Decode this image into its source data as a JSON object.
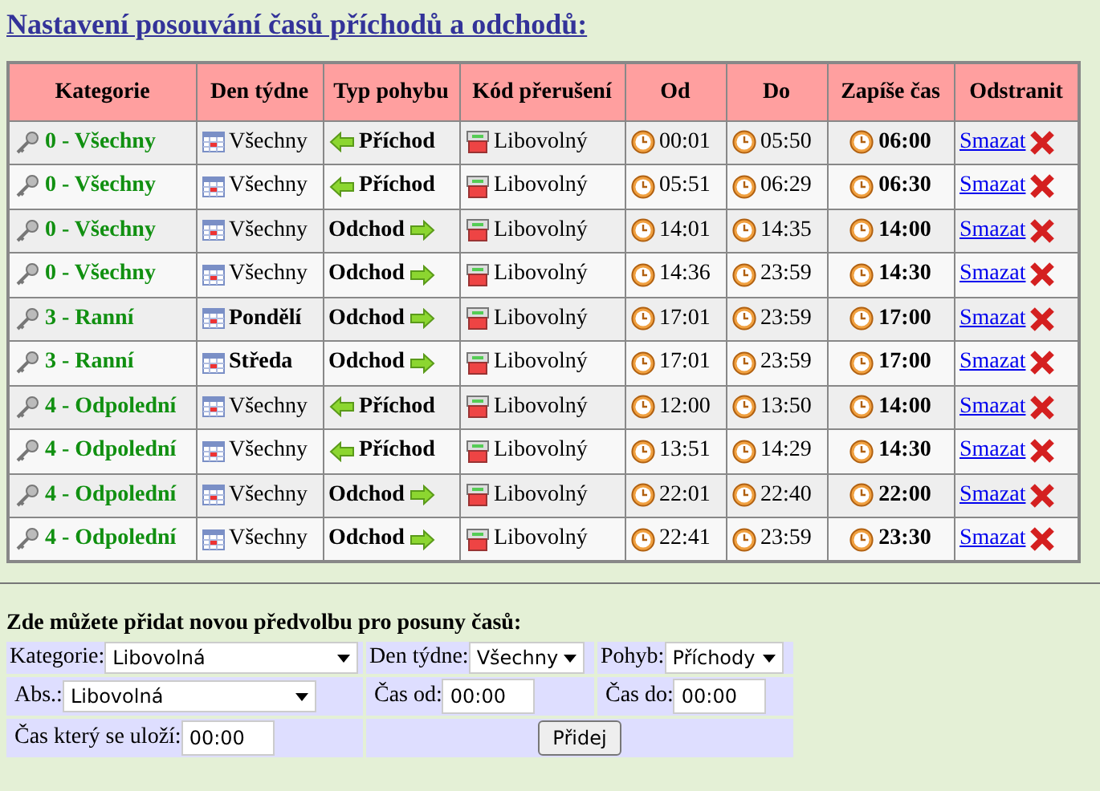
{
  "title": "Nastavení posouvání časů příchodů a odchodů:",
  "table": {
    "columns": [
      "Kategorie",
      "Den týdne",
      "Typ pohybu",
      "Kód přerušení",
      "Od",
      "Do",
      "Zapíše čas",
      "Odstranit"
    ],
    "rows": [
      {
        "category": "0 - Všechny",
        "day": "Všechny",
        "day_bold": false,
        "movement": "Příchod",
        "kind": "in",
        "code": "Libovolný",
        "from": "00:01",
        "to": "05:50",
        "save": "06:00",
        "delete": "Smazat"
      },
      {
        "category": "0 - Všechny",
        "day": "Všechny",
        "day_bold": false,
        "movement": "Příchod",
        "kind": "in",
        "code": "Libovolný",
        "from": "05:51",
        "to": "06:29",
        "save": "06:30",
        "delete": "Smazat"
      },
      {
        "category": "0 - Všechny",
        "day": "Všechny",
        "day_bold": false,
        "movement": "Odchod",
        "kind": "out",
        "code": "Libovolný",
        "from": "14:01",
        "to": "14:35",
        "save": "14:00",
        "delete": "Smazat"
      },
      {
        "category": "0 - Všechny",
        "day": "Všechny",
        "day_bold": false,
        "movement": "Odchod",
        "kind": "out",
        "code": "Libovolný",
        "from": "14:36",
        "to": "23:59",
        "save": "14:30",
        "delete": "Smazat"
      },
      {
        "category": "3 - Ranní",
        "day": "Pondělí",
        "day_bold": true,
        "movement": "Odchod",
        "kind": "out",
        "code": "Libovolný",
        "from": "17:01",
        "to": "23:59",
        "save": "17:00",
        "delete": "Smazat"
      },
      {
        "category": "3 - Ranní",
        "day": "Středa",
        "day_bold": true,
        "movement": "Odchod",
        "kind": "out",
        "code": "Libovolný",
        "from": "17:01",
        "to": "23:59",
        "save": "17:00",
        "delete": "Smazat"
      },
      {
        "category": "4 - Odpolední",
        "day": "Všechny",
        "day_bold": false,
        "movement": "Příchod",
        "kind": "in",
        "code": "Libovolný",
        "from": "12:00",
        "to": "13:50",
        "save": "14:00",
        "delete": "Smazat"
      },
      {
        "category": "4 - Odpolední",
        "day": "Všechny",
        "day_bold": false,
        "movement": "Příchod",
        "kind": "in",
        "code": "Libovolný",
        "from": "13:51",
        "to": "14:29",
        "save": "14:30",
        "delete": "Smazat"
      },
      {
        "category": "4 - Odpolední",
        "day": "Všechny",
        "day_bold": false,
        "movement": "Odchod",
        "kind": "out",
        "code": "Libovolný",
        "from": "22:01",
        "to": "22:40",
        "save": "22:00",
        "delete": "Smazat"
      },
      {
        "category": "4 - Odpolední",
        "day": "Všechny",
        "day_bold": false,
        "movement": "Odchod",
        "kind": "out",
        "code": "Libovolný",
        "from": "22:41",
        "to": "23:59",
        "save": "23:30",
        "delete": "Smazat"
      }
    ]
  },
  "form": {
    "heading": "Zde můžete přidat novou předvolbu pro posuny časů:",
    "category": {
      "label": "Kategorie:",
      "value": "Libovolná"
    },
    "day": {
      "label": "Den týdne:",
      "value": "Všechny"
    },
    "movement": {
      "label": "Pohyb:",
      "value": "Příchody"
    },
    "abs": {
      "label": "Abs.:",
      "value": "Libovolná"
    },
    "time_from": {
      "label": "Čas od:",
      "value": "00:00"
    },
    "time_to": {
      "label": "Čas do:",
      "value": "00:00"
    },
    "save_time": {
      "label": "Čas který se uloží:",
      "value": "00:00"
    },
    "add_button": "Přidej"
  }
}
